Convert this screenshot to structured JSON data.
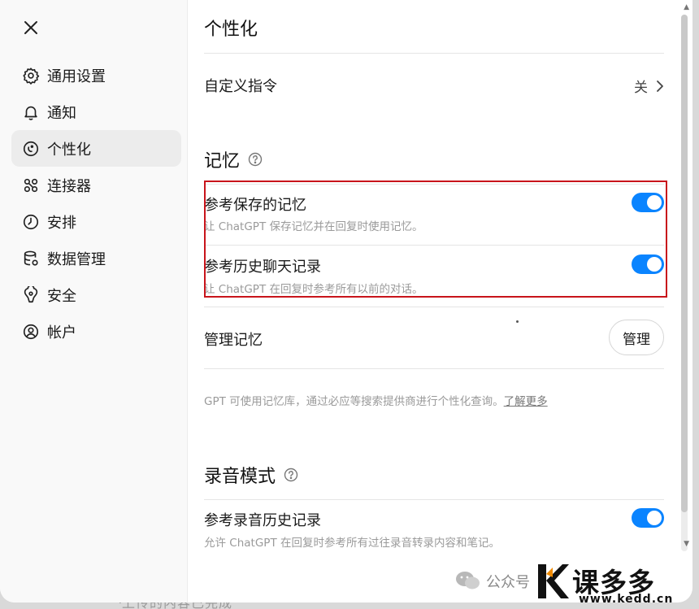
{
  "backdrop": {
    "text": "上传的内容已完成"
  },
  "sidebar": {
    "close_icon": "close-icon",
    "items": [
      {
        "label": "通用设置",
        "icon": "gear-icon",
        "active": false
      },
      {
        "label": "通知",
        "icon": "bell-icon",
        "active": false
      },
      {
        "label": "个性化",
        "icon": "personalization-icon",
        "active": true
      },
      {
        "label": "连接器",
        "icon": "connectors-icon",
        "active": false
      },
      {
        "label": "安排",
        "icon": "clock-icon",
        "active": false
      },
      {
        "label": "数据管理",
        "icon": "database-icon",
        "active": false
      },
      {
        "label": "安全",
        "icon": "shield-icon",
        "active": false
      },
      {
        "label": "帐户",
        "icon": "user-circle-icon",
        "active": false
      }
    ]
  },
  "main": {
    "title": "个性化",
    "custom_instructions": {
      "label": "自定义指令",
      "value": "关"
    },
    "memory": {
      "title": "记忆",
      "saved_memory": {
        "label": "参考保存的记忆",
        "desc": "让 ChatGPT 保存记忆并在回复时使用记忆。",
        "enabled": true
      },
      "chat_history": {
        "label": "参考历史聊天记录",
        "desc": "让 ChatGPT 在回复时参考所有以前的对话。",
        "enabled": true
      },
      "manage": {
        "label": "管理记忆",
        "button": "管理"
      },
      "footnote": "GPT 可使用记忆库，通过必应等搜索提供商进行个性化查询。",
      "learn_more": "了解更多"
    },
    "voice": {
      "title": "录音模式",
      "history": {
        "label": "参考录音历史记录",
        "desc": "允许 ChatGPT 在回复时参考所有过往录音转录内容和笔记。",
        "enabled": true
      }
    }
  },
  "watermark": {
    "wechat_text": "公众号",
    "brand": "课多多",
    "url": "www.kedd.cn"
  },
  "colors": {
    "toggle_on": "#0a84ff",
    "highlight_border": "#c8141b",
    "sidebar_bg": "#f9f9f9",
    "active_item_bg": "#ececec"
  }
}
